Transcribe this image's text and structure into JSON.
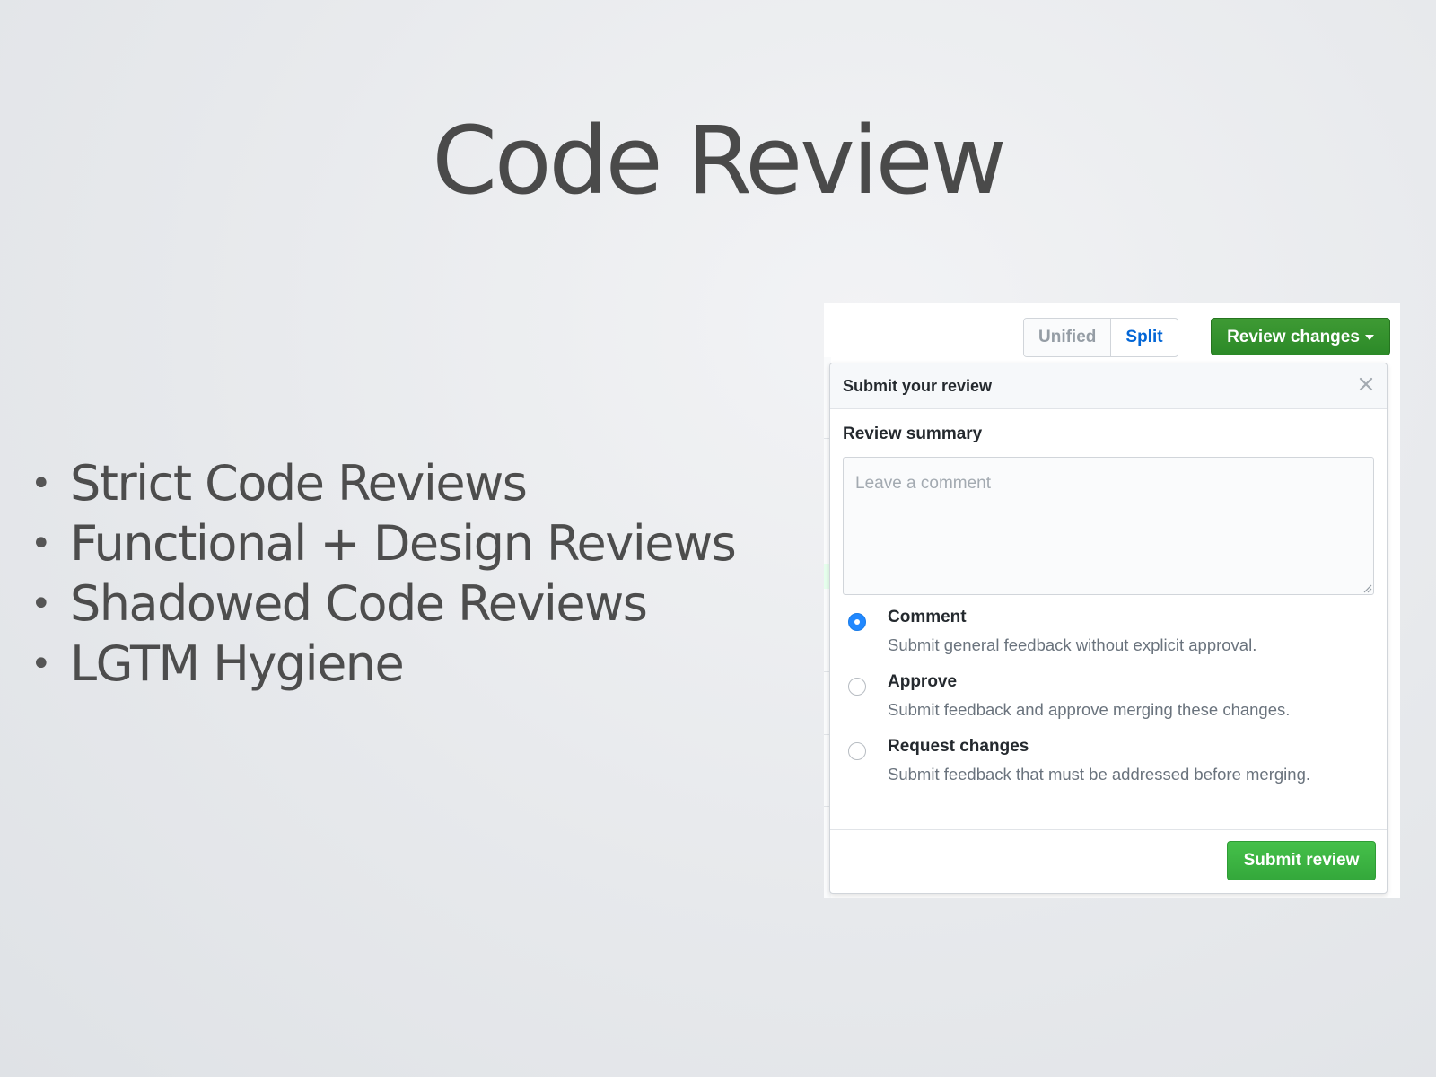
{
  "slide": {
    "title": "Code Review",
    "bullets": [
      "Strict Code Reviews",
      "Functional + Design Reviews",
      "Shadowed Code Reviews",
      "LGTM Hygiene"
    ]
  },
  "diff_toolbar": {
    "view_modes": [
      "Unified",
      "Split"
    ],
    "selected_view_mode": "Split",
    "review_button_label": "Review changes"
  },
  "review_dialog": {
    "title": "Submit your review",
    "summary_label": "Review summary",
    "comment_placeholder": "Leave a comment",
    "comment_value": "",
    "options": [
      {
        "label": "Comment",
        "description": "Submit general feedback without explicit approval.",
        "selected": true
      },
      {
        "label": "Approve",
        "description": "Submit feedback and approve merging these changes.",
        "selected": false
      },
      {
        "label": "Request changes",
        "description": "Submit feedback that must be addressed before merging.",
        "selected": false
      }
    ],
    "submit_label": "Submit review"
  },
  "icons": {
    "close": "close-icon",
    "dropdown": "caret-down-icon",
    "resize": "resize-grip-icon"
  },
  "colors": {
    "primary_green": "#2c8a28",
    "submit_green": "#34a83b",
    "link_blue": "#0366d6",
    "radio_selected": "#2188ff",
    "title_text": "#4a4a4a"
  }
}
